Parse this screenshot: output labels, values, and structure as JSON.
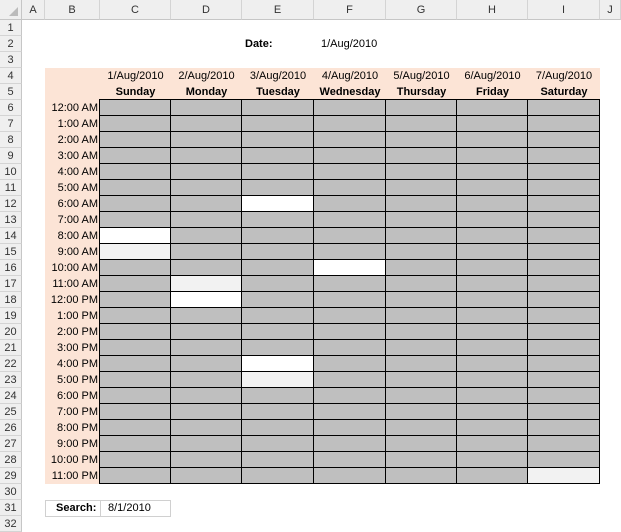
{
  "columns": [
    "A",
    "B",
    "C",
    "D",
    "E",
    "F",
    "G",
    "H",
    "I",
    "J"
  ],
  "rows": [
    "1",
    "2",
    "3",
    "4",
    "5",
    "6",
    "7",
    "8",
    "9",
    "10",
    "11",
    "12",
    "13",
    "14",
    "15",
    "16",
    "17",
    "18",
    "19",
    "20",
    "21",
    "22",
    "23",
    "24",
    "25",
    "26",
    "27",
    "28",
    "29",
    "30",
    "31",
    "32"
  ],
  "date_label": "Date:",
  "date_value": "1/Aug/2010",
  "days": [
    {
      "date": "1/Aug/2010",
      "name": "Sunday"
    },
    {
      "date": "2/Aug/2010",
      "name": "Monday"
    },
    {
      "date": "3/Aug/2010",
      "name": "Tuesday"
    },
    {
      "date": "4/Aug/2010",
      "name": "Wednesday"
    },
    {
      "date": "5/Aug/2010",
      "name": "Thursday"
    },
    {
      "date": "6/Aug/2010",
      "name": "Friday"
    },
    {
      "date": "7/Aug/2010",
      "name": "Saturday"
    }
  ],
  "times": [
    "12:00 AM",
    "1:00 AM",
    "2:00 AM",
    "3:00 AM",
    "4:00 AM",
    "5:00 AM",
    "6:00 AM",
    "7:00 AM",
    "8:00 AM",
    "9:00 AM",
    "10:00 AM",
    "11:00 AM",
    "12:00 PM",
    "1:00 PM",
    "2:00 PM",
    "3:00 PM",
    "4:00 PM",
    "5:00 PM",
    "6:00 PM",
    "7:00 PM",
    "8:00 PM",
    "9:00 PM",
    "10:00 PM",
    "11:00 PM"
  ],
  "free_slots": [
    {
      "day": 0,
      "hour": 8,
      "shade": "#ffffff"
    },
    {
      "day": 0,
      "hour": 9,
      "shade": "#f2f2f2"
    },
    {
      "day": 1,
      "hour": 11,
      "shade": "#f2f2f2"
    },
    {
      "day": 1,
      "hour": 12,
      "shade": "#ffffff"
    },
    {
      "day": 2,
      "hour": 6,
      "shade": "#ffffff"
    },
    {
      "day": 2,
      "hour": 16,
      "shade": "#ffffff"
    },
    {
      "day": 2,
      "hour": 17,
      "shade": "#f2f2f2"
    },
    {
      "day": 3,
      "hour": 10,
      "shade": "#ffffff"
    },
    {
      "day": 6,
      "hour": 23,
      "shade": "#f2f2f2"
    }
  ],
  "colors": {
    "busy": "#bfbfbf",
    "header_fill": "#fce4d6"
  },
  "search_label": "Search:",
  "search_value": "8/1/2010"
}
